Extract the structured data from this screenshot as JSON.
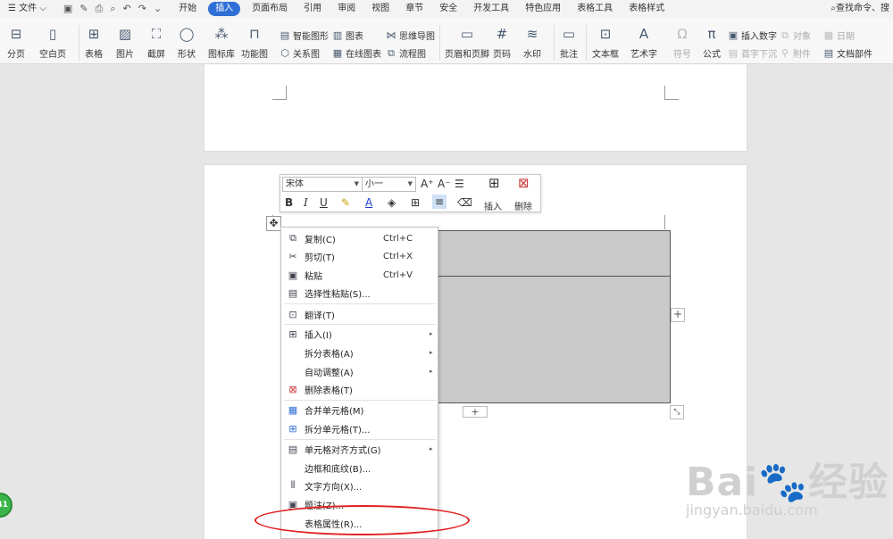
{
  "menubar": {
    "file": "文件",
    "tabs": [
      "开始",
      "插入",
      "页面布局",
      "引用",
      "审阅",
      "视图",
      "章节",
      "安全",
      "开发工具",
      "特色应用",
      "表格工具",
      "表格样式"
    ],
    "active_tab": "插入",
    "search": "查找命令、搜"
  },
  "ribbon": {
    "page_break": "分页",
    "blank_page": "空白页",
    "table": "表格",
    "picture": "图片",
    "screenshot": "截屏",
    "shape": "形状",
    "icon_lib": "图标库",
    "func_chart": "功能图",
    "smart_graphic": "智能图形",
    "chart": "图表",
    "mind_map": "思维导图",
    "relation_chart": "关系图",
    "online_chart": "在线图表",
    "flowchart": "流程图",
    "header_footer": "页眉和页脚",
    "page_number": "页码",
    "watermark": "水印",
    "comment": "批注",
    "textbox": "文本框",
    "wordart": "艺术字",
    "symbol": "符号",
    "formula": "公式",
    "insert_number": "插入数字",
    "object": "对象",
    "date": "日期",
    "drop_cap": "首字下沉",
    "attachment": "附件",
    "doc_parts": "文档部件"
  },
  "minitoolbar": {
    "font": "宋体",
    "size": "小一",
    "insert": "插入",
    "delete": "删除"
  },
  "context_menu": {
    "items": [
      {
        "label": "复制(C)",
        "shortcut": "Ctrl+C"
      },
      {
        "label": "剪切(T)",
        "shortcut": "Ctrl+X"
      },
      {
        "label": "粘贴",
        "shortcut": "Ctrl+V"
      },
      {
        "label": "选择性粘贴(S)...",
        "shortcut": ""
      },
      {
        "label": "翻译(T)",
        "shortcut": ""
      },
      {
        "label": "插入(I)",
        "shortcut": ""
      },
      {
        "label": "拆分表格(A)",
        "shortcut": ""
      },
      {
        "label": "自动调整(A)",
        "shortcut": ""
      },
      {
        "label": "删除表格(T)",
        "shortcut": ""
      },
      {
        "label": "合并单元格(M)",
        "shortcut": ""
      },
      {
        "label": "拆分单元格(T)...",
        "shortcut": ""
      },
      {
        "label": "单元格对齐方式(G)",
        "shortcut": ""
      },
      {
        "label": "边框和底纹(B)...",
        "shortcut": ""
      },
      {
        "label": "文字方向(X)...",
        "shortcut": ""
      },
      {
        "label": "题注(Z)...",
        "shortcut": ""
      },
      {
        "label": "表格属性(R)...",
        "shortcut": ""
      }
    ]
  },
  "badge": "41",
  "watermark": {
    "logo": "Bai🐾经验",
    "url": "jingyan.baidu.com"
  },
  "colors": {
    "accent": "#2f6fd6",
    "highlight": "#e02020",
    "table_fill": "#c9c9c9",
    "badge": "#3bb54a"
  }
}
